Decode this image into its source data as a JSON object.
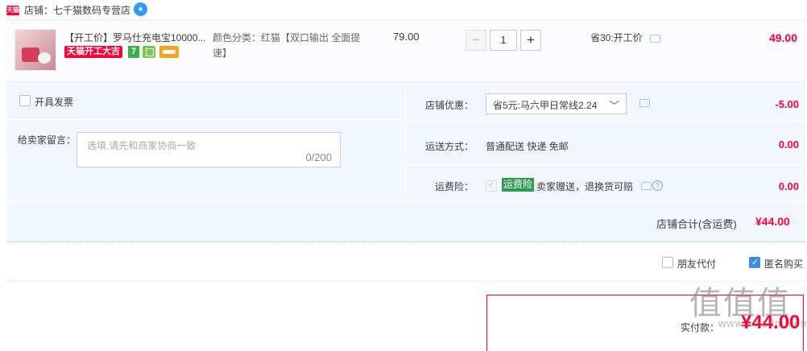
{
  "shop": {
    "badge": "天猫",
    "name": "店铺：七千猫数码专营店",
    "chat_glyph": "●"
  },
  "item": {
    "title": "【开工价】罗马仕充电宝10000...",
    "promo_tag": "天猫开工大吉",
    "seven_day_badge": "7",
    "sku": "颜色分类：红猫【双口输出 全面提速】",
    "unit_price": "79.00",
    "quantity": "1",
    "minus_label": "−",
    "plus_label": "+",
    "save_text": "省30:开工价",
    "total": "49.00"
  },
  "options": {
    "invoice_label": "开具发票",
    "message_label": "给卖家留言：",
    "message_placeholder": "选填,请先和商家协商一致",
    "message_count": "0/200",
    "shop_discount_label": "店铺优惠：",
    "shop_discount_value": "省5元:马六甲日常线2.24",
    "shop_discount_amount": "-5.00",
    "shipping_label": "运送方式：",
    "shipping_value": "普通配送 快递 免邮",
    "shipping_amount": "0.00",
    "insurance_label": "运费险：",
    "insurance_tag": "运费险",
    "insurance_text": "卖家赠送，退换货可赔",
    "insurance_amount": "0.00",
    "help_glyph": "?"
  },
  "shop_total": {
    "label": "店铺合计(含运费)",
    "value": "¥44.00"
  },
  "checkout": {
    "friend_pay_label": "朋友代付",
    "anonymous_label": "匿名购买",
    "anonymous_checked": true,
    "pay_label": "实付款：",
    "pay_value": "¥44.00"
  },
  "watermark": {
    "big": "值值值",
    "small": "www.smzdm.com"
  },
  "colors": {
    "accent": "#ff0036",
    "panel_bg": "#f2f7ff",
    "check_blue": "#3a8ee6",
    "insurance_green": "#2d9b4e"
  }
}
